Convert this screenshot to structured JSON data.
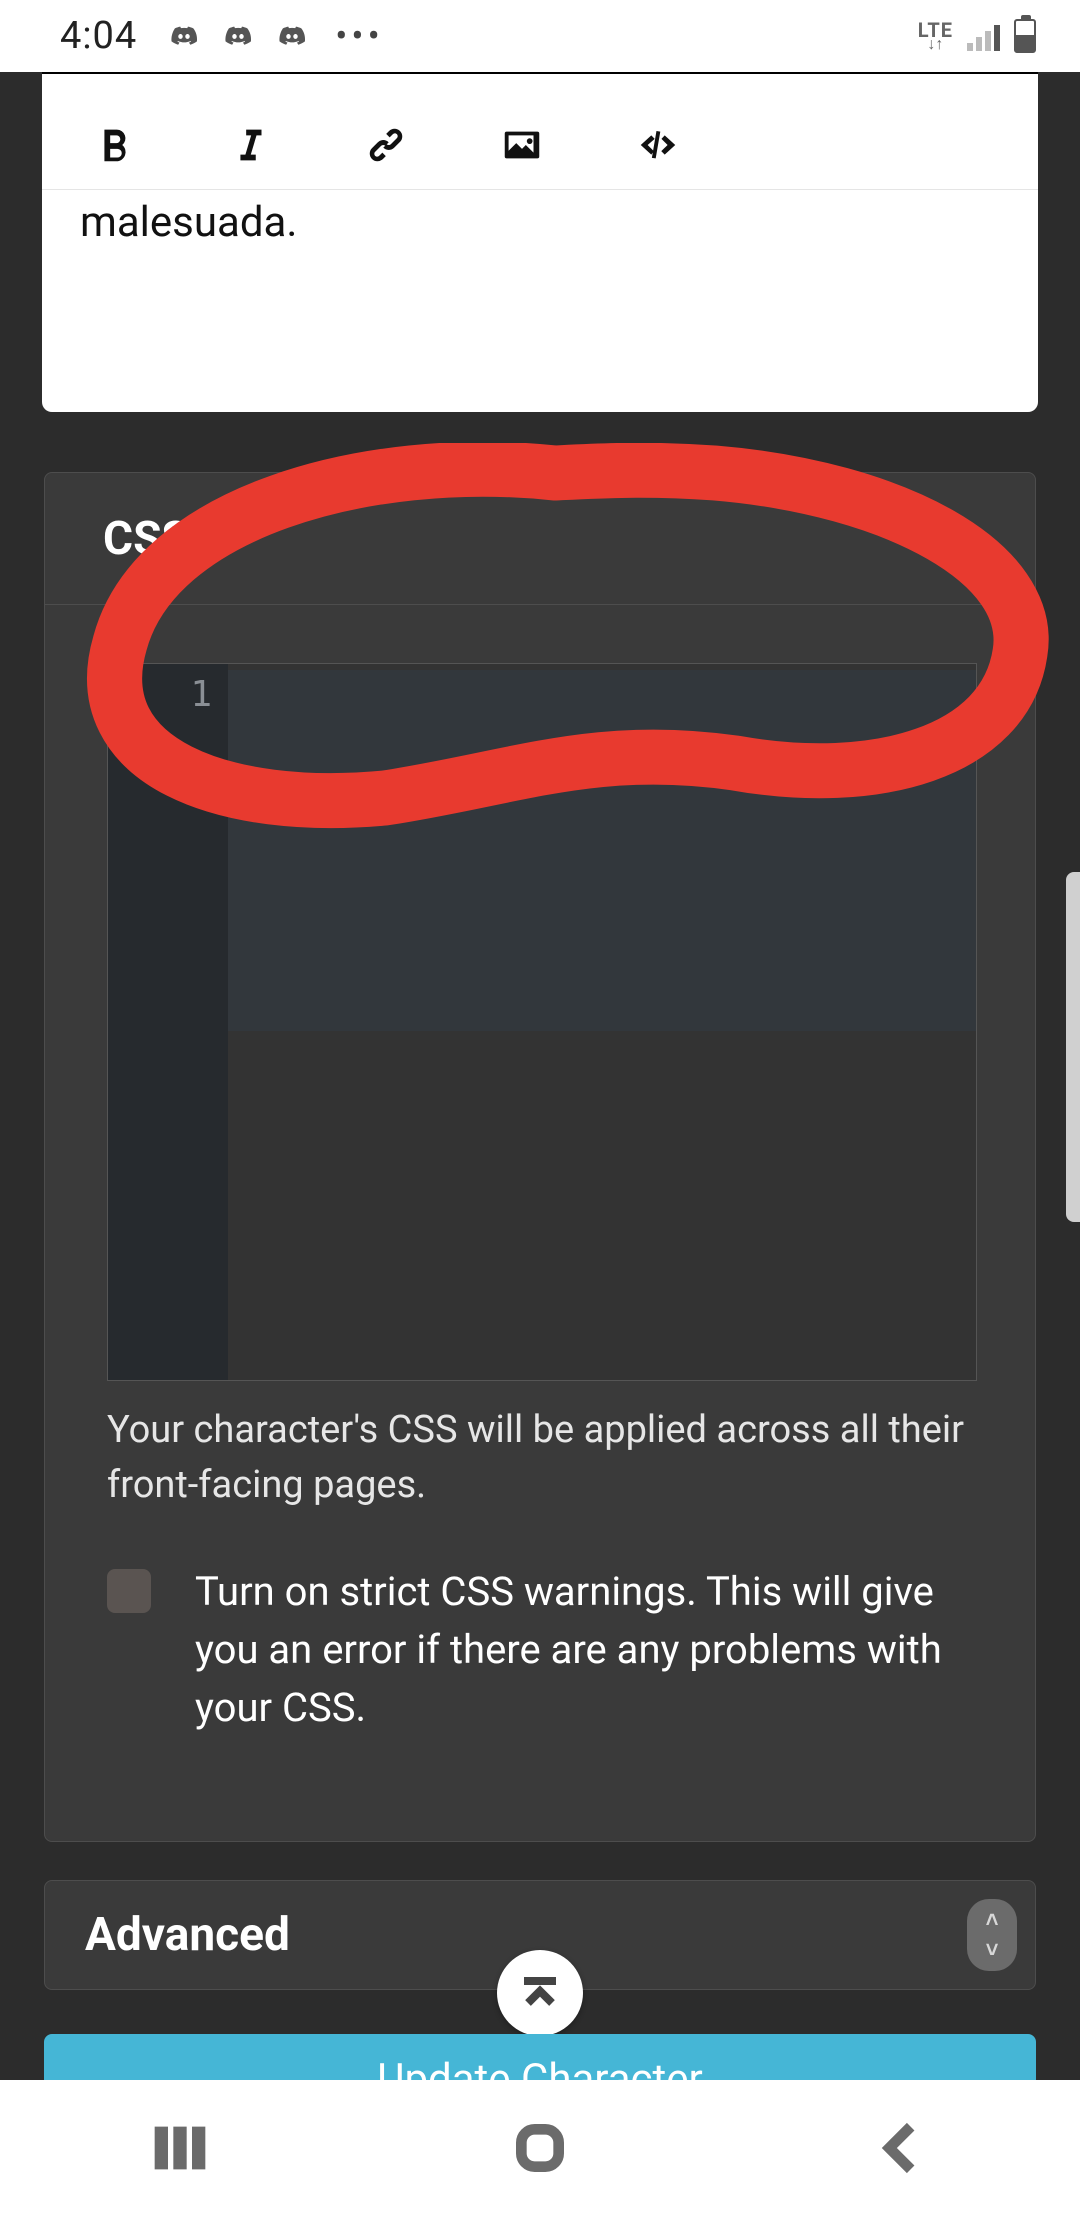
{
  "statusbar": {
    "time": "4:04",
    "network_label": "LTE"
  },
  "editor": {
    "body_text": "malesuada."
  },
  "css_panel": {
    "title": "CSS",
    "line_number": "1",
    "code_value": "",
    "help_text": "Your character's CSS will be applied across all their front-facing pages.",
    "strict_label": "Turn on strict CSS warnings. This will give you an error if there are any problems with your CSS."
  },
  "advanced": {
    "title": "Advanced"
  },
  "buttons": {
    "update": "Update Character"
  }
}
